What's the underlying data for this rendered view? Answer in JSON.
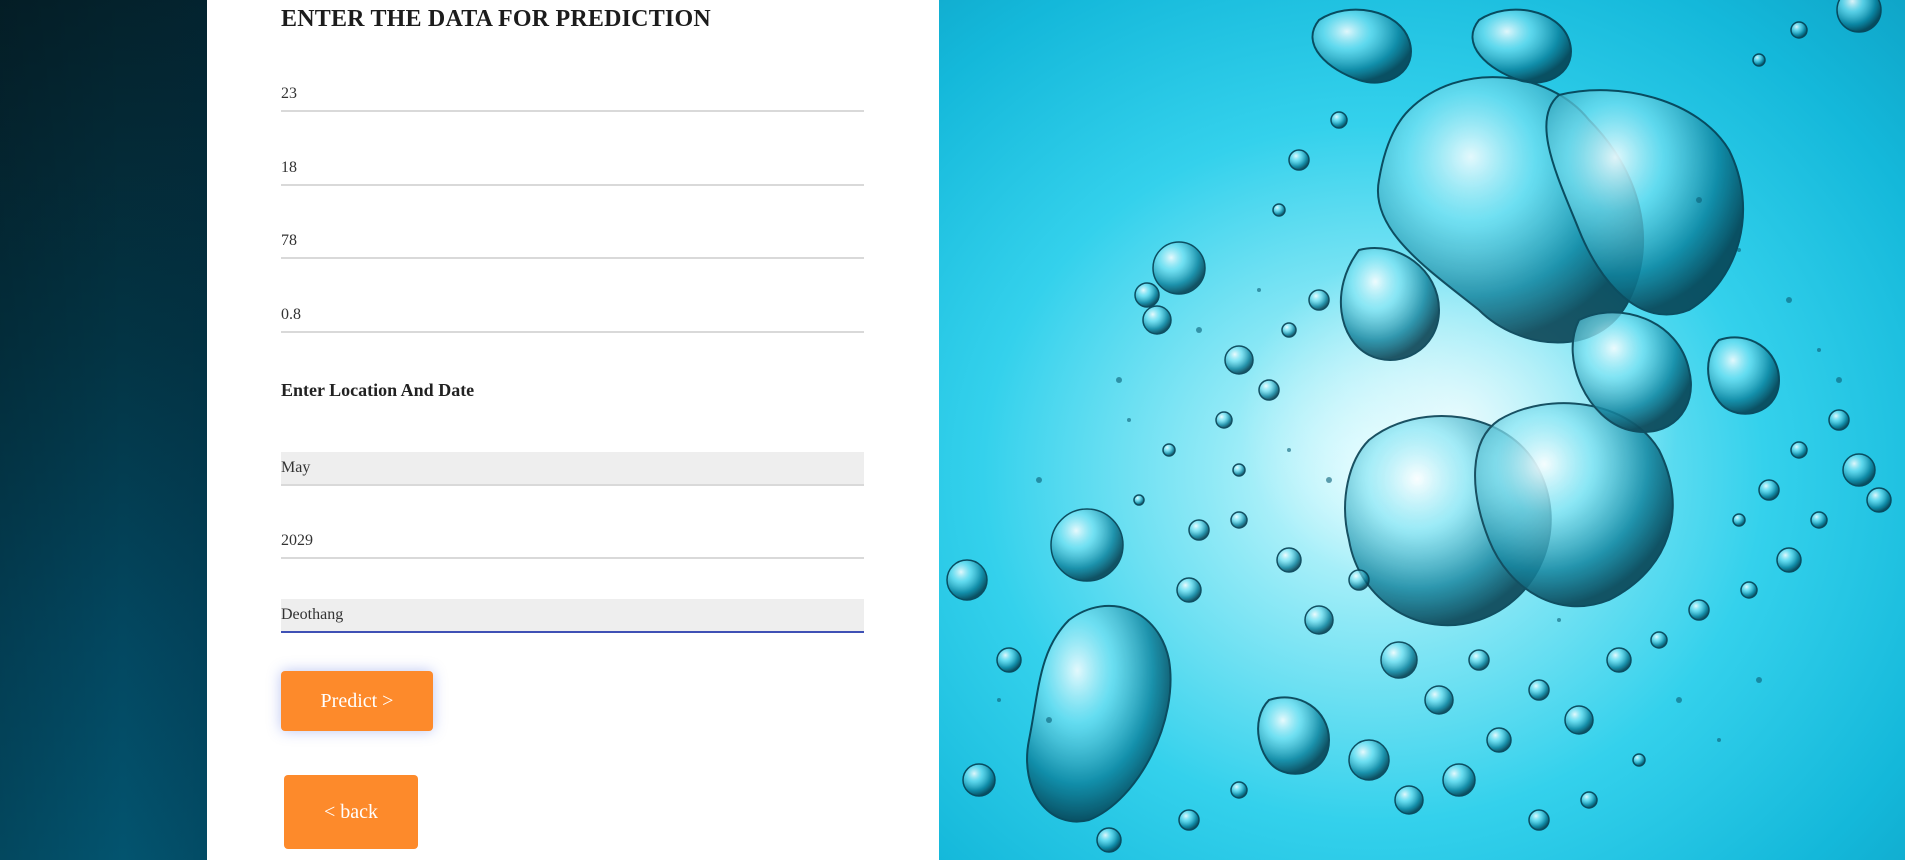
{
  "form": {
    "title": "ENTER THE DATA FOR PREDICTION",
    "fields": [
      {
        "value": "23"
      },
      {
        "value": "18"
      },
      {
        "value": "78"
      },
      {
        "value": "0.8"
      }
    ],
    "location_heading": "Enter Location And Date",
    "month": "May",
    "year": "2029",
    "location": "Deothang",
    "predict_label": "Predict >",
    "back_label": "< back"
  },
  "theme": {
    "accent": "#fd8a2b",
    "focus": "#3f51b5",
    "background_image": "water-bubbles-image"
  }
}
